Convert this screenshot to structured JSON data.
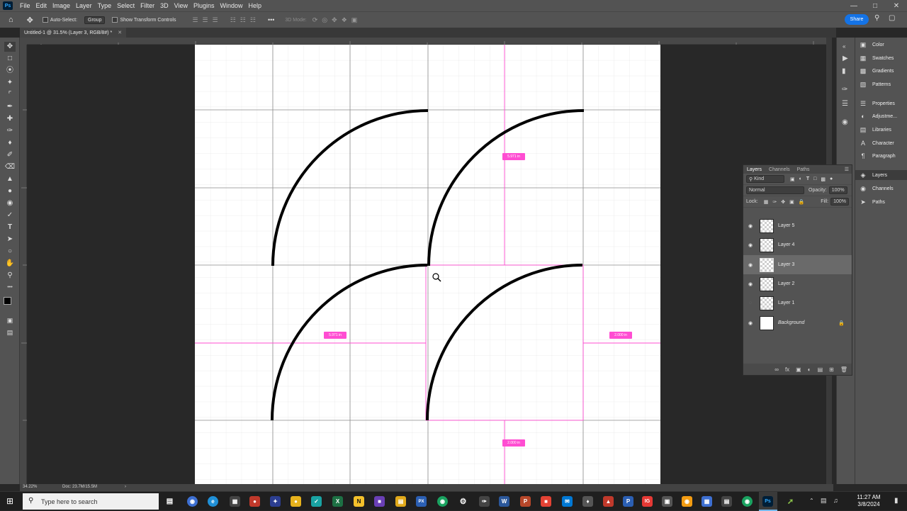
{
  "app": {
    "logo_text": "Ps",
    "menu": [
      "File",
      "Edit",
      "Image",
      "Layer",
      "Type",
      "Select",
      "Filter",
      "3D",
      "View",
      "Plugins",
      "Window",
      "Help"
    ]
  },
  "options": {
    "auto_select_label": "Auto-Select:",
    "auto_select_value": "Group",
    "show_transform_label": "Show Transform Controls",
    "mode_3d_label": "3D Mode:",
    "share_label": "Share"
  },
  "document": {
    "tab_title": "Untitled-1 @ 31.5% (Layer 3, RGB/8#) *",
    "zoom": "34.22%",
    "doc_info": "Doc: 23.7M/15.5M"
  },
  "measurements": {
    "top_right": "5.971 in",
    "left_mid": "5.971 in",
    "right_mid": "2.000 in",
    "bottom": "2.000 in"
  },
  "dock": {
    "group1": [
      "Color",
      "Swatches",
      "Gradients",
      "Patterns"
    ],
    "group2": [
      "Properties",
      "Adjustme...",
      "Libraries",
      "Character",
      "Paragraph"
    ],
    "group3": [
      "Layers",
      "Channels",
      "Paths"
    ]
  },
  "layers_panel": {
    "tabs": [
      "Layers",
      "Channels",
      "Paths"
    ],
    "filter_kind": "Kind",
    "blend_mode": "Normal",
    "opacity_label": "Opacity:",
    "opacity_value": "100%",
    "lock_label": "Lock:",
    "fill_label": "Fill:",
    "fill_value": "100%",
    "layers": [
      {
        "name": "Layer 5",
        "visible": true,
        "selected": false
      },
      {
        "name": "Layer 4",
        "visible": true,
        "selected": false
      },
      {
        "name": "Layer 3",
        "visible": true,
        "selected": true
      },
      {
        "name": "Layer 2",
        "visible": true,
        "selected": false
      },
      {
        "name": "Layer 1",
        "visible": false,
        "selected": false
      },
      {
        "name": "Background",
        "visible": true,
        "selected": false,
        "locked": true
      }
    ]
  },
  "taskbar": {
    "search_placeholder": "Type here to search",
    "time": "11:27 AM",
    "date": "3/8/2024"
  },
  "colors": {
    "guide": "#ff4dd2",
    "accent": "#1473e6",
    "panel": "#535353"
  }
}
